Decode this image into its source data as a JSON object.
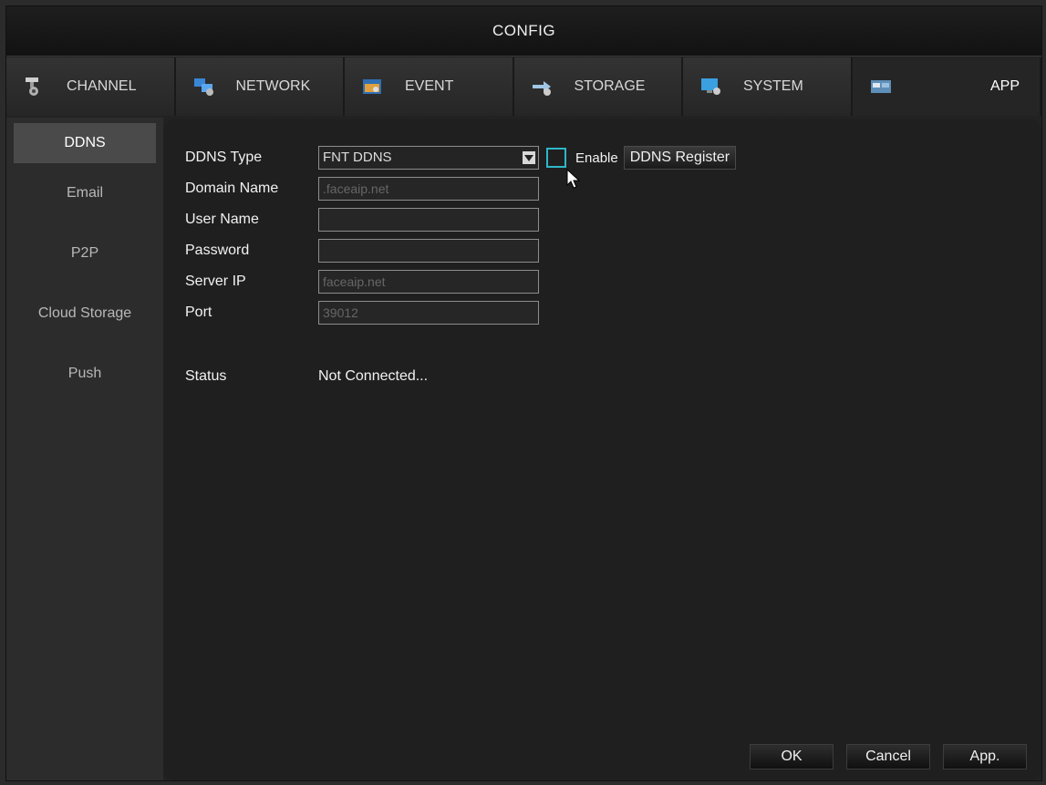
{
  "title": "CONFIG",
  "tabs": [
    {
      "label": "CHANNEL",
      "icon": "camera-icon"
    },
    {
      "label": "NETWORK",
      "icon": "network-icon"
    },
    {
      "label": "EVENT",
      "icon": "event-icon"
    },
    {
      "label": "STORAGE",
      "icon": "storage-icon"
    },
    {
      "label": "SYSTEM",
      "icon": "system-icon"
    },
    {
      "label": "APP",
      "icon": "app-icon",
      "active": true
    }
  ],
  "sidebar": {
    "items": [
      {
        "label": "DDNS",
        "active": true
      },
      {
        "label": "Email"
      },
      {
        "label": "P2P"
      },
      {
        "label": "Cloud Storage"
      },
      {
        "label": "Push"
      }
    ]
  },
  "form": {
    "ddns_type": {
      "label": "DDNS Type",
      "value": "FNT DDNS"
    },
    "enable": {
      "label": "Enable",
      "checked": false
    },
    "register_button": "DDNS Register",
    "domain_name": {
      "label": "Domain Name",
      "value": ".faceaip.net"
    },
    "user_name": {
      "label": "User Name",
      "value": ""
    },
    "password": {
      "label": "Password",
      "value": ""
    },
    "server_ip": {
      "label": "Server IP",
      "value": "faceaip.net"
    },
    "port": {
      "label": "Port",
      "value": "39012"
    },
    "status": {
      "label": "Status",
      "value": "Not Connected..."
    }
  },
  "buttons": {
    "ok": "OK",
    "cancel": "Cancel",
    "apply": "App."
  },
  "colors": {
    "accent": "#2fb6c8",
    "background": "#222222",
    "panel": "#1f1f1f"
  }
}
